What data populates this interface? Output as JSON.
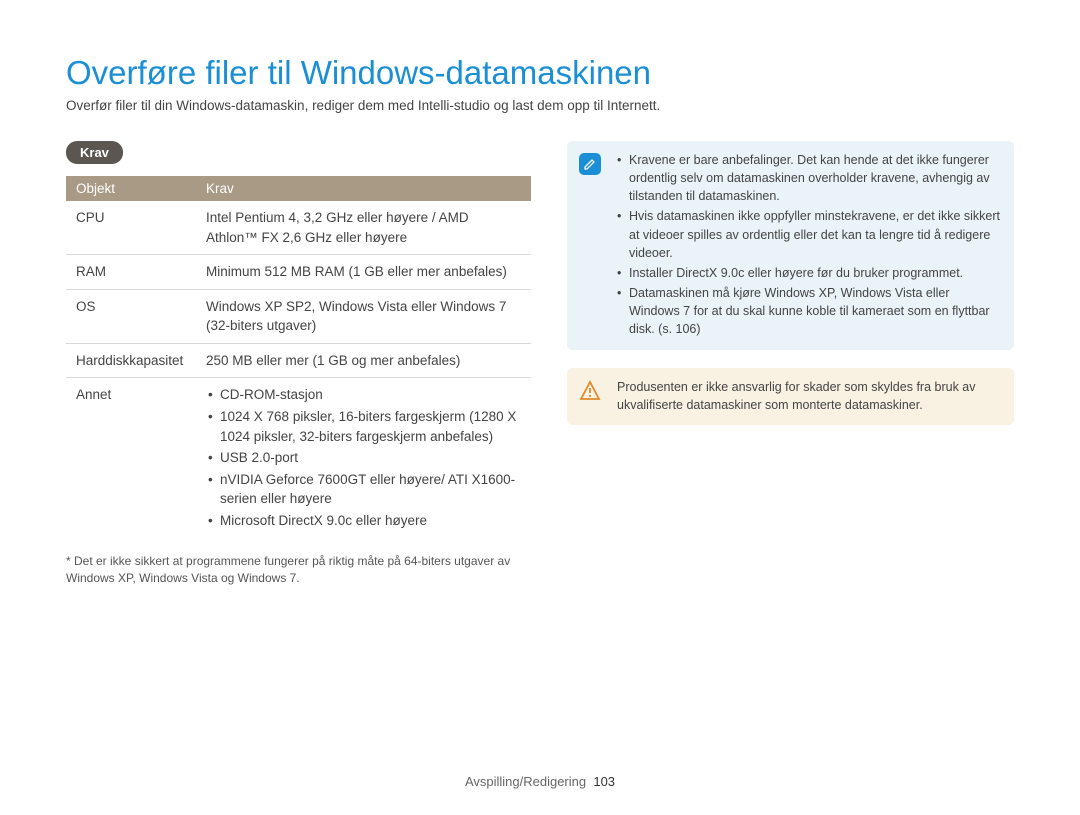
{
  "title": "Overføre filer til Windows-datamaskinen",
  "subtitle": "Overfør filer til din Windows-datamaskin, rediger dem med Intelli-studio og last dem opp til Internett.",
  "section_label": "Krav",
  "table": {
    "headers": {
      "col1": "Objekt",
      "col2": "Krav"
    },
    "rows": {
      "cpu": {
        "label": "CPU",
        "value": "Intel Pentium 4, 3,2 GHz eller høyere / AMD Athlon™ FX 2,6 GHz eller høyere"
      },
      "ram": {
        "label": "RAM",
        "value": "Minimum 512 MB RAM (1 GB eller mer anbefales)"
      },
      "os": {
        "label": "OS",
        "value": "Windows XP SP2, Windows Vista eller Windows 7 (32-biters utgaver)"
      },
      "hdd": {
        "label": "Harddiskkapasitet",
        "value": "250 MB eller mer (1 GB og mer anbefales)"
      },
      "other": {
        "label": "Annet",
        "items": {
          "a": "CD-ROM-stasjon",
          "b": "1024 X 768 piksler, 16-biters fargeskjerm (1280 X 1024 piksler, 32-biters fargeskjerm anbefales)",
          "c": "USB 2.0-port",
          "d": "nVIDIA Geforce 7600GT eller høyere/ ATI X1600-serien eller høyere",
          "e": "Microsoft DirectX 9.0c eller høyere"
        }
      }
    }
  },
  "footnote": "* Det er ikke sikkert at programmene fungerer på riktig måte på 64-biters utgaver av Windows XP, Windows Vista og Windows 7.",
  "info_note": {
    "items": {
      "a": "Kravene er bare anbefalinger. Det kan hende at det ikke fungerer ordentlig selv om datamaskinen overholder kravene, avhengig av tilstanden til datamaskinen.",
      "b": "Hvis datamaskinen ikke oppfyller minstekravene, er det ikke sikkert at videoer spilles av ordentlig eller det kan ta lengre tid å redigere videoer.",
      "c": "Installer DirectX 9.0c eller høyere før du bruker programmet.",
      "d": "Datamaskinen må kjøre Windows XP, Windows Vista eller Windows 7 for at du skal kunne koble til kameraet som en flyttbar disk. (s. 106)"
    }
  },
  "warn_note": "Produsenten er ikke ansvarlig for skader som skyldes fra bruk av ukvalifiserte datamaskiner som monterte datamaskiner.",
  "footer": {
    "section": "Avspilling/Redigering",
    "page": "103"
  }
}
